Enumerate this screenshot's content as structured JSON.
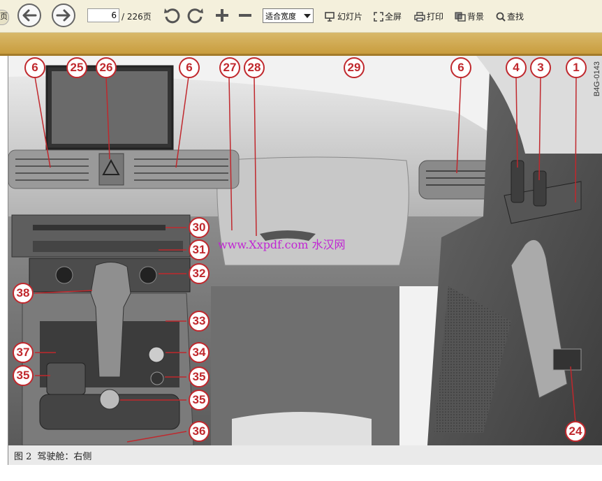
{
  "toolbar": {
    "prev_label": "页",
    "page_current": "6",
    "page_total": "/ 226页",
    "zoom_value": "适合宽度",
    "slideshow_label": "幻灯片",
    "fullscreen_label": "全屏",
    "print_label": "打印",
    "background_label": "背景",
    "search_label": "查找"
  },
  "figure": {
    "code": "B4G-0143",
    "watermark": "www.Xxpdf.com 水汉网",
    "callouts": [
      "6",
      "25",
      "26",
      "6",
      "27",
      "28",
      "29",
      "6",
      "4",
      "3",
      "1",
      "30",
      "31",
      "32",
      "38",
      "33",
      "37",
      "34",
      "35",
      "35",
      "35",
      "36",
      "24"
    ]
  },
  "caption": {
    "number": "图 2",
    "text": "驾驶舱：右侧"
  },
  "colors": {
    "toolbar_bg": "#f4f0dc",
    "band": "#c99d3e",
    "callout": "#c0282d"
  }
}
